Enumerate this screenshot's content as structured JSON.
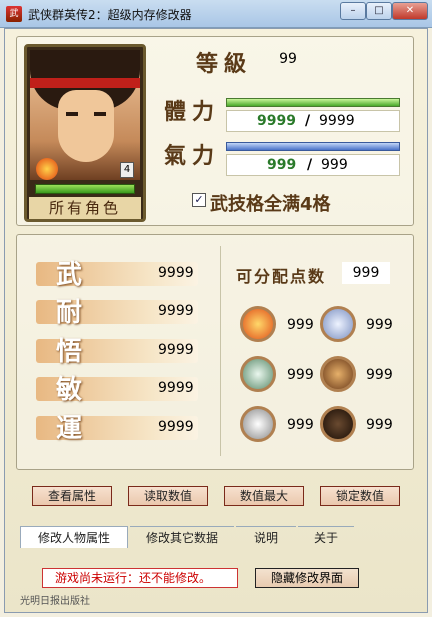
{
  "window": {
    "title": "武侠群英传2：超级内存修改器",
    "min": "–",
    "max": "□",
    "close": "✕"
  },
  "character": {
    "portrait_label": "所有角色",
    "badge_num": "4",
    "level_label": "等級",
    "level_value": "99",
    "hp_label": "體力",
    "hp_current": "9999",
    "hp_max": "9999",
    "mp_label": "氣力",
    "mp_current": "999",
    "mp_max": "999",
    "separator": "/",
    "martial_checkbox_label": "武技格全满4格",
    "martial_checked": true
  },
  "attributes": [
    {
      "char": "武",
      "value": "9999"
    },
    {
      "char": "耐",
      "value": "9999"
    },
    {
      "char": "悟",
      "value": "9999"
    },
    {
      "char": "敏",
      "value": "9999"
    },
    {
      "char": "運",
      "value": "9999"
    }
  ],
  "points": {
    "label": "可分配点数",
    "value": "999"
  },
  "skills": [
    {
      "icon": "fire-icon",
      "value": "999",
      "color": "#e0501a"
    },
    {
      "icon": "ice-crystal-icon",
      "value": "999",
      "color": "#9db0d6"
    },
    {
      "icon": "tornado-icon",
      "value": "999",
      "color": "#6a9a7a"
    },
    {
      "icon": "rock-icon",
      "value": "999",
      "color": "#9a6a3a"
    },
    {
      "icon": "blade-icon",
      "value": "999",
      "color": "#c8c8c8"
    },
    {
      "icon": "bull-icon",
      "value": "999",
      "color": "#2a1a10"
    }
  ],
  "buttons": [
    "查看属性",
    "读取数值",
    "数值最大",
    "锁定数值"
  ],
  "tabs": [
    "修改人物属性",
    "修改其它数据",
    "说明",
    "关于"
  ],
  "status_text": "游戏尚未运行：还不能修改。",
  "hide_button": "隐藏修改界面",
  "footer_text": "光明日报出版社"
}
